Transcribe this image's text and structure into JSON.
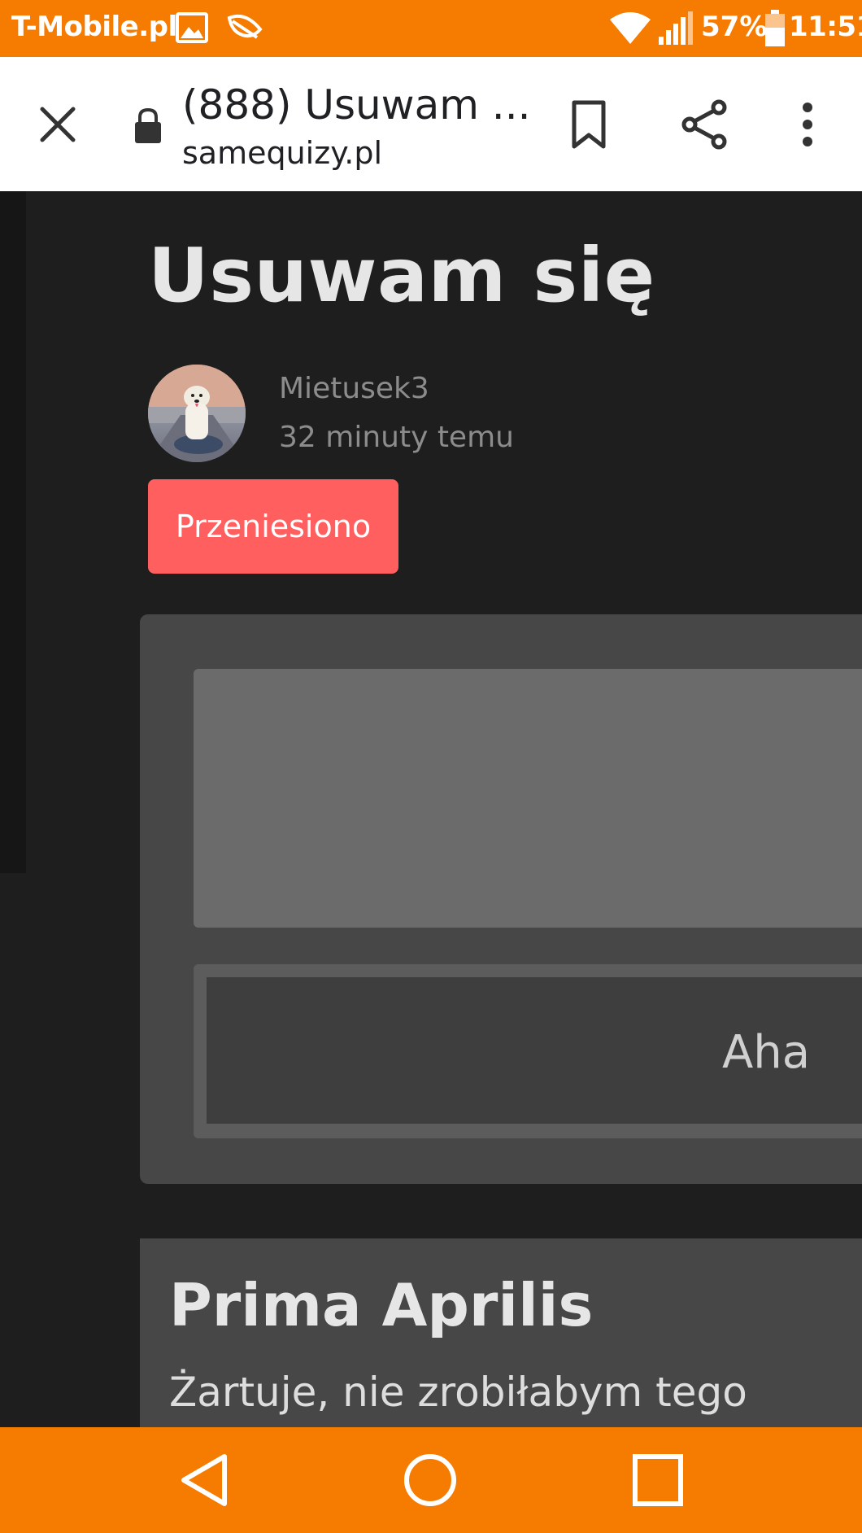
{
  "status_bar": {
    "carrier": "T-Mobile.pl",
    "battery_percent": "57%",
    "time": "11:51",
    "icons": [
      "gallery-icon",
      "leaf-icon",
      "wifi-icon",
      "signal-icon",
      "battery-icon"
    ],
    "background": "#f57c00"
  },
  "browser": {
    "page_title": "(888) Usuwam ...",
    "url": "samequizy.pl",
    "icons": [
      "close-icon",
      "lock-icon",
      "bookmark-icon",
      "share-icon",
      "more-vert-icon"
    ]
  },
  "post": {
    "title": "Usuwam się",
    "author": "Mietusek3",
    "time_ago": "32 minuty temu",
    "tag": "Przeniesiono",
    "tag_color": "#ff5f5f"
  },
  "quiz": {
    "answer": "Aha"
  },
  "result": {
    "title": "Prima Aprilis",
    "description": "Żartuje, nie zrobiłabym tego"
  },
  "nav_bar": {
    "icons": [
      "back-icon",
      "home-icon",
      "recents-icon"
    ]
  }
}
